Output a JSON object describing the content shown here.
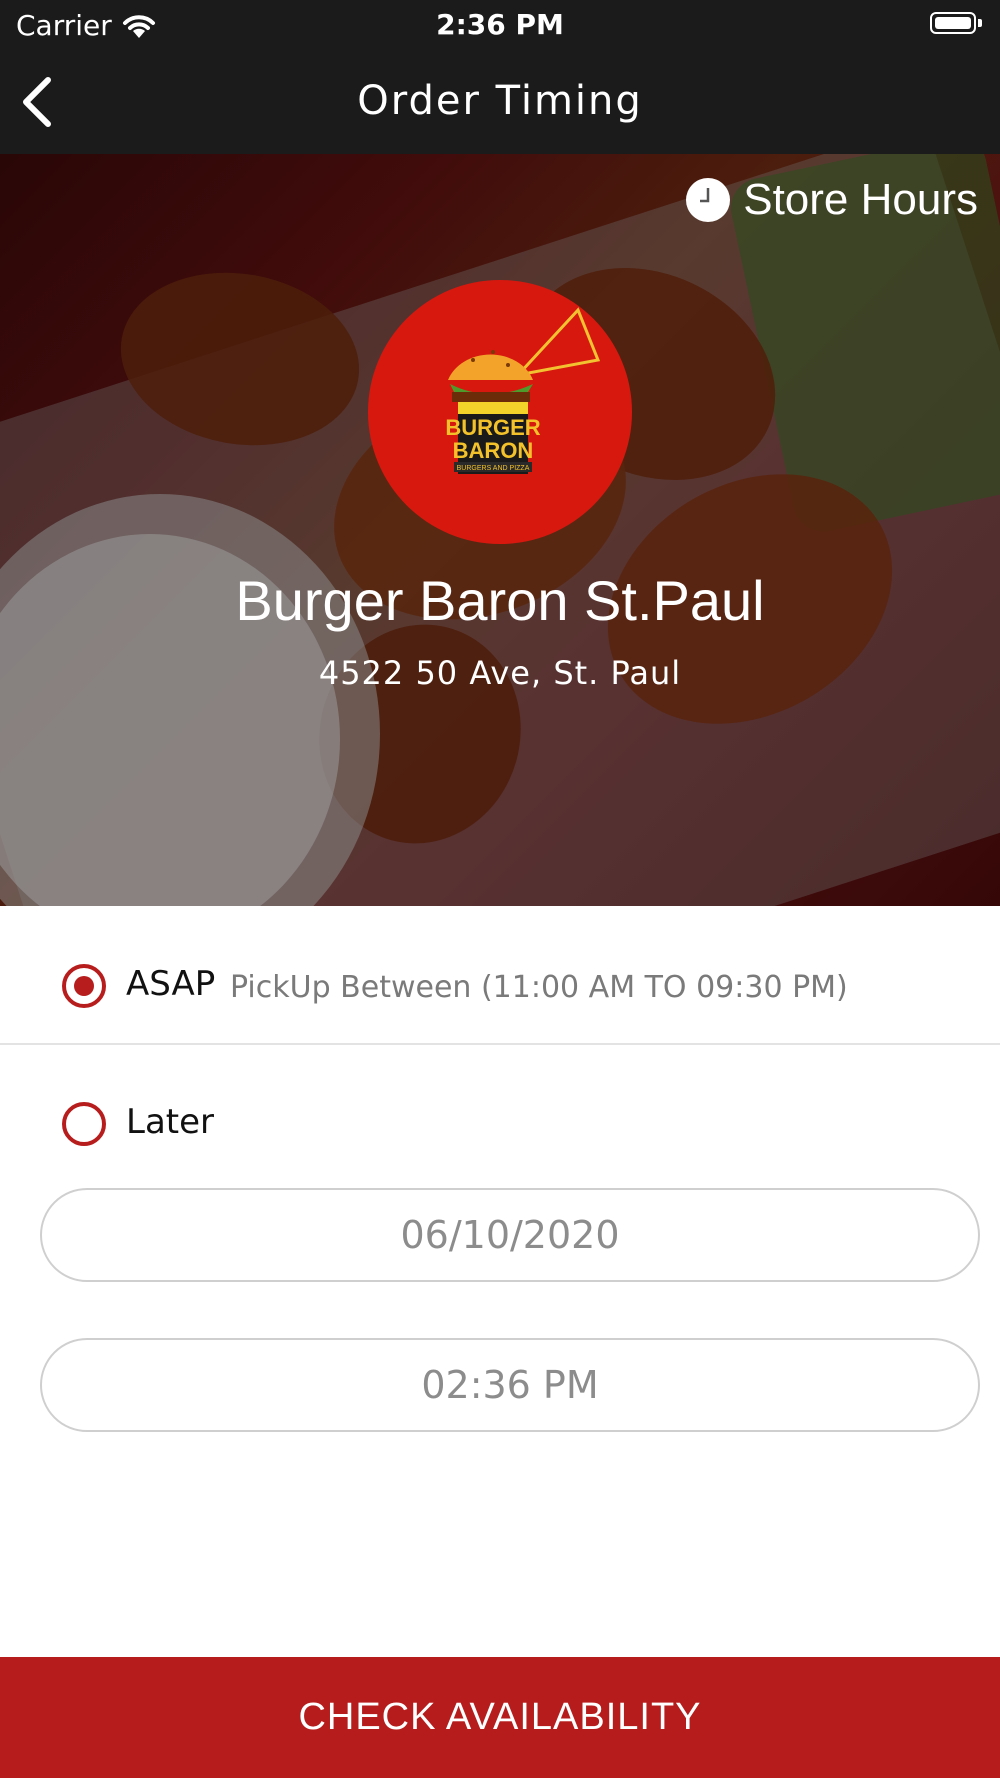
{
  "status_bar": {
    "carrier": "Carrier",
    "time": "2:36 PM"
  },
  "nav": {
    "title": "Order Timing",
    "back_icon": "chevron-left-icon"
  },
  "hero": {
    "store_hours_label": "Store Hours",
    "store_hours_icon": "clock-icon",
    "logo": {
      "line1": "BURGER",
      "line2": "BARON",
      "tagline": "BURGERS AND PIZZA"
    },
    "store_name": "Burger Baron St.Paul",
    "store_address": "4522 50 Ave, St. Paul"
  },
  "timing_options": {
    "asap": {
      "label": "ASAP",
      "note": "PickUp Between (11:00 AM TO 09:30 PM)",
      "selected": true
    },
    "later": {
      "label": "Later",
      "selected": false
    }
  },
  "fields": {
    "date_value": "06/10/2020",
    "time_value": "02:36 PM"
  },
  "footer": {
    "check_button_label": "CHECK AVAILABILITY"
  },
  "colors": {
    "accent": "#b71c1c",
    "header_bg": "#1b1b1b",
    "logo_bg": "#d7180f"
  }
}
